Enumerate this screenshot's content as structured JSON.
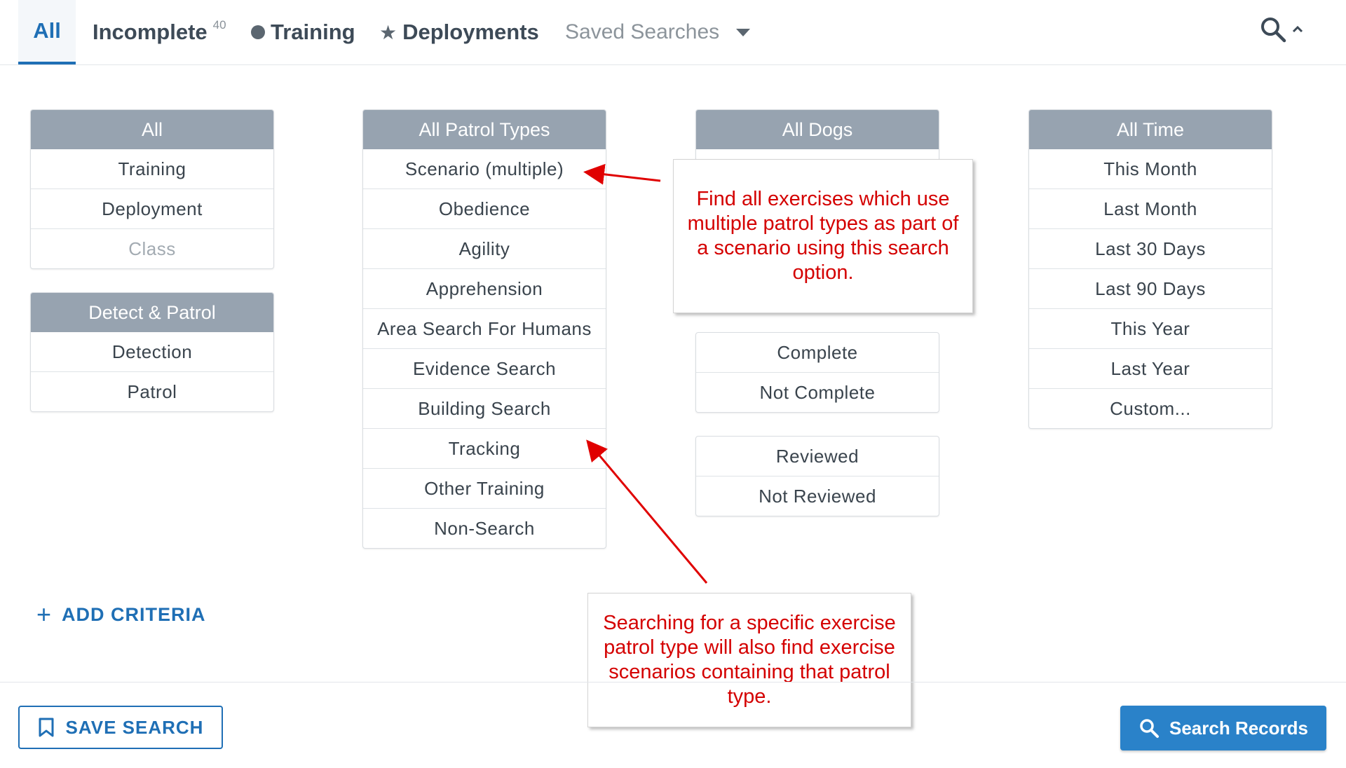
{
  "tabs": {
    "all": "All",
    "incomplete": "Incomplete",
    "incomplete_count": "40",
    "training": "Training",
    "deployments": "Deployments",
    "saved_searches": "Saved Searches"
  },
  "icons": {
    "training_dot": "filled-circle-icon",
    "deployments_star": "star-icon",
    "saved_caret": "caret-down-icon",
    "search": "search-icon",
    "collapse": "chevron-up-icon",
    "bookmark": "bookmark-icon",
    "add": "plus-icon"
  },
  "filters": {
    "type": {
      "header": "All",
      "options": [
        "Training",
        "Deployment",
        "Class"
      ]
    },
    "detect": {
      "header": "Detect & Patrol",
      "options": [
        "Detection",
        "Patrol"
      ]
    },
    "patrol": {
      "header": "All Patrol Types",
      "options": [
        "Scenario (multiple)",
        "Obedience",
        "Agility",
        "Apprehension",
        "Area Search For Humans",
        "Evidence Search",
        "Building Search",
        "Tracking",
        "Other Training",
        "Non-Search"
      ]
    },
    "dogs": {
      "header": "All Dogs"
    },
    "complete": {
      "options": [
        "Complete",
        "Not Complete"
      ]
    },
    "reviewed": {
      "options": [
        "Reviewed",
        "Not Reviewed"
      ]
    },
    "time": {
      "header": "All Time",
      "options": [
        "This Month",
        "Last Month",
        "Last 30 Days",
        "Last 90 Days",
        "This Year",
        "Last Year",
        "Custom..."
      ]
    }
  },
  "callouts": {
    "scenario": "Find all exercises which use multiple patrol types as part of a scenario using this search option.",
    "specific": "Searching for a specific exercise patrol type will also find exercise scenarios containing that patrol type."
  },
  "actions": {
    "add_criteria": "ADD CRITERIA",
    "save_search": "SAVE SEARCH",
    "search_records": "Search Records"
  },
  "colors": {
    "accent": "#1f6fb5",
    "primary_button": "#2a82c9",
    "header_gray": "#97a3b0",
    "annotation_red": "#d40000"
  }
}
